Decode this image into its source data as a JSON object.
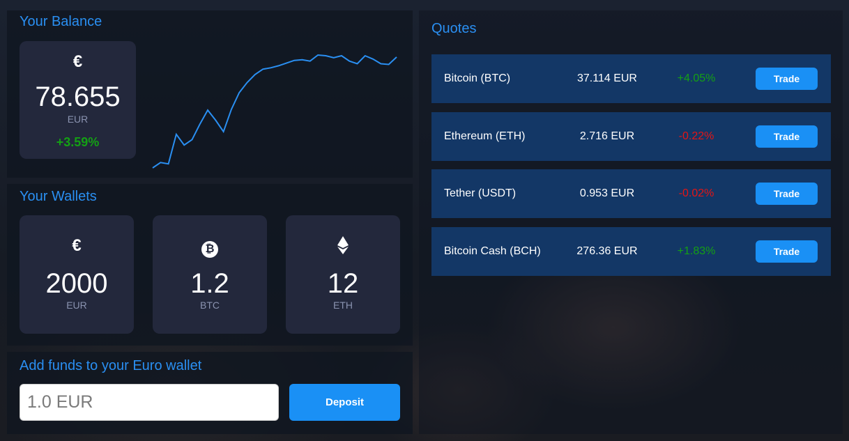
{
  "balance": {
    "title": "Your Balance",
    "symbol": "€",
    "amount": "78.655",
    "currency": "EUR",
    "change": "+3.59%",
    "change_color": "#14a014",
    "sparkline": [
      3,
      11,
      9,
      53,
      37,
      45,
      68,
      89,
      74,
      57,
      90,
      115,
      130,
      142,
      150,
      152,
      155,
      159,
      163,
      164,
      162,
      171,
      170,
      167,
      170,
      162,
      158,
      170,
      165,
      158,
      157,
      168
    ]
  },
  "wallets": {
    "title": "Your Wallets",
    "items": [
      {
        "symbol": "€",
        "icon": "euro-icon",
        "amount": "2000",
        "unit": "EUR"
      },
      {
        "symbol": "₿",
        "icon": "bitcoin-icon",
        "amount": "1.2",
        "unit": "BTC"
      },
      {
        "symbol": "◆",
        "icon": "ethereum-icon",
        "amount": "12",
        "unit": "ETH"
      }
    ]
  },
  "add_funds": {
    "title": "Add funds to your Euro wallet",
    "placeholder": "1.0 EUR",
    "value": "",
    "button_label": "Deposit"
  },
  "quotes": {
    "title": "Quotes",
    "trade_label": "Trade",
    "rows": [
      {
        "name": "Bitcoin (BTC)",
        "price": "37.114 EUR",
        "change": "+4.05%",
        "direction": "up"
      },
      {
        "name": "Ethereum (ETH)",
        "price": "2.716 EUR",
        "change": "-0.22%",
        "direction": "down"
      },
      {
        "name": "Tether (USDT)",
        "price": "0.953 EUR",
        "change": "-0.02%",
        "direction": "down"
      },
      {
        "name": "Bitcoin Cash (BCH)",
        "price": "276.36 EUR",
        "change": "+1.83%",
        "direction": "up"
      }
    ]
  },
  "colors": {
    "accent": "#2a8ff2",
    "button": "#1a90f5",
    "card": "#23283c",
    "quote_row": "#133766",
    "positive": "#14a014",
    "negative": "#e61414"
  }
}
